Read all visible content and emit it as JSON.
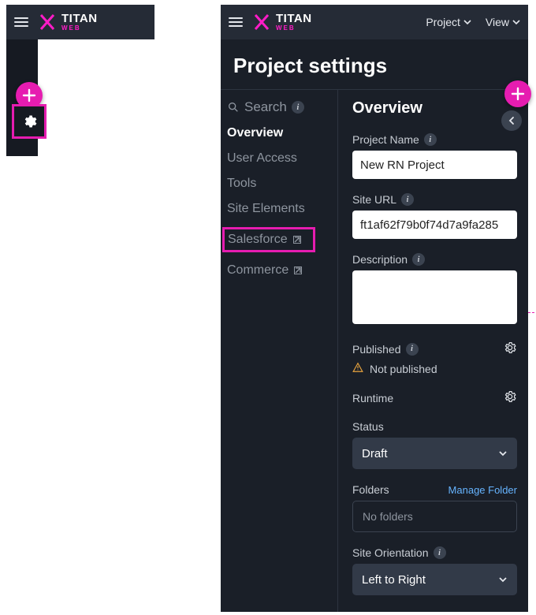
{
  "brand": {
    "name": "TITAN",
    "sub": "WEB"
  },
  "topnav": {
    "project": "Project",
    "view": "View"
  },
  "page_title": "Project settings",
  "sidenav": {
    "search": "Search",
    "items": [
      {
        "label": "Overview",
        "active": true
      },
      {
        "label": "User Access"
      },
      {
        "label": "Tools"
      },
      {
        "label": "Site Elements"
      },
      {
        "label": "Salesforce",
        "external": true,
        "highlight": true
      },
      {
        "label": "Commerce",
        "external": true
      }
    ]
  },
  "form": {
    "title": "Overview",
    "project_name": {
      "label": "Project Name",
      "value": "New RN Project"
    },
    "site_url": {
      "label": "Site URL",
      "value": "ft1af62f79b0f74d7a9fa285"
    },
    "description": {
      "label": "Description",
      "value": ""
    },
    "published": {
      "label": "Published",
      "status": "Not published"
    },
    "runtime": {
      "label": "Runtime"
    },
    "status": {
      "label": "Status",
      "value": "Draft"
    },
    "folders": {
      "label": "Folders",
      "value": "No folders",
      "manage": "Manage Folder"
    },
    "orientation": {
      "label": "Site Orientation",
      "value": "Left to Right"
    }
  }
}
